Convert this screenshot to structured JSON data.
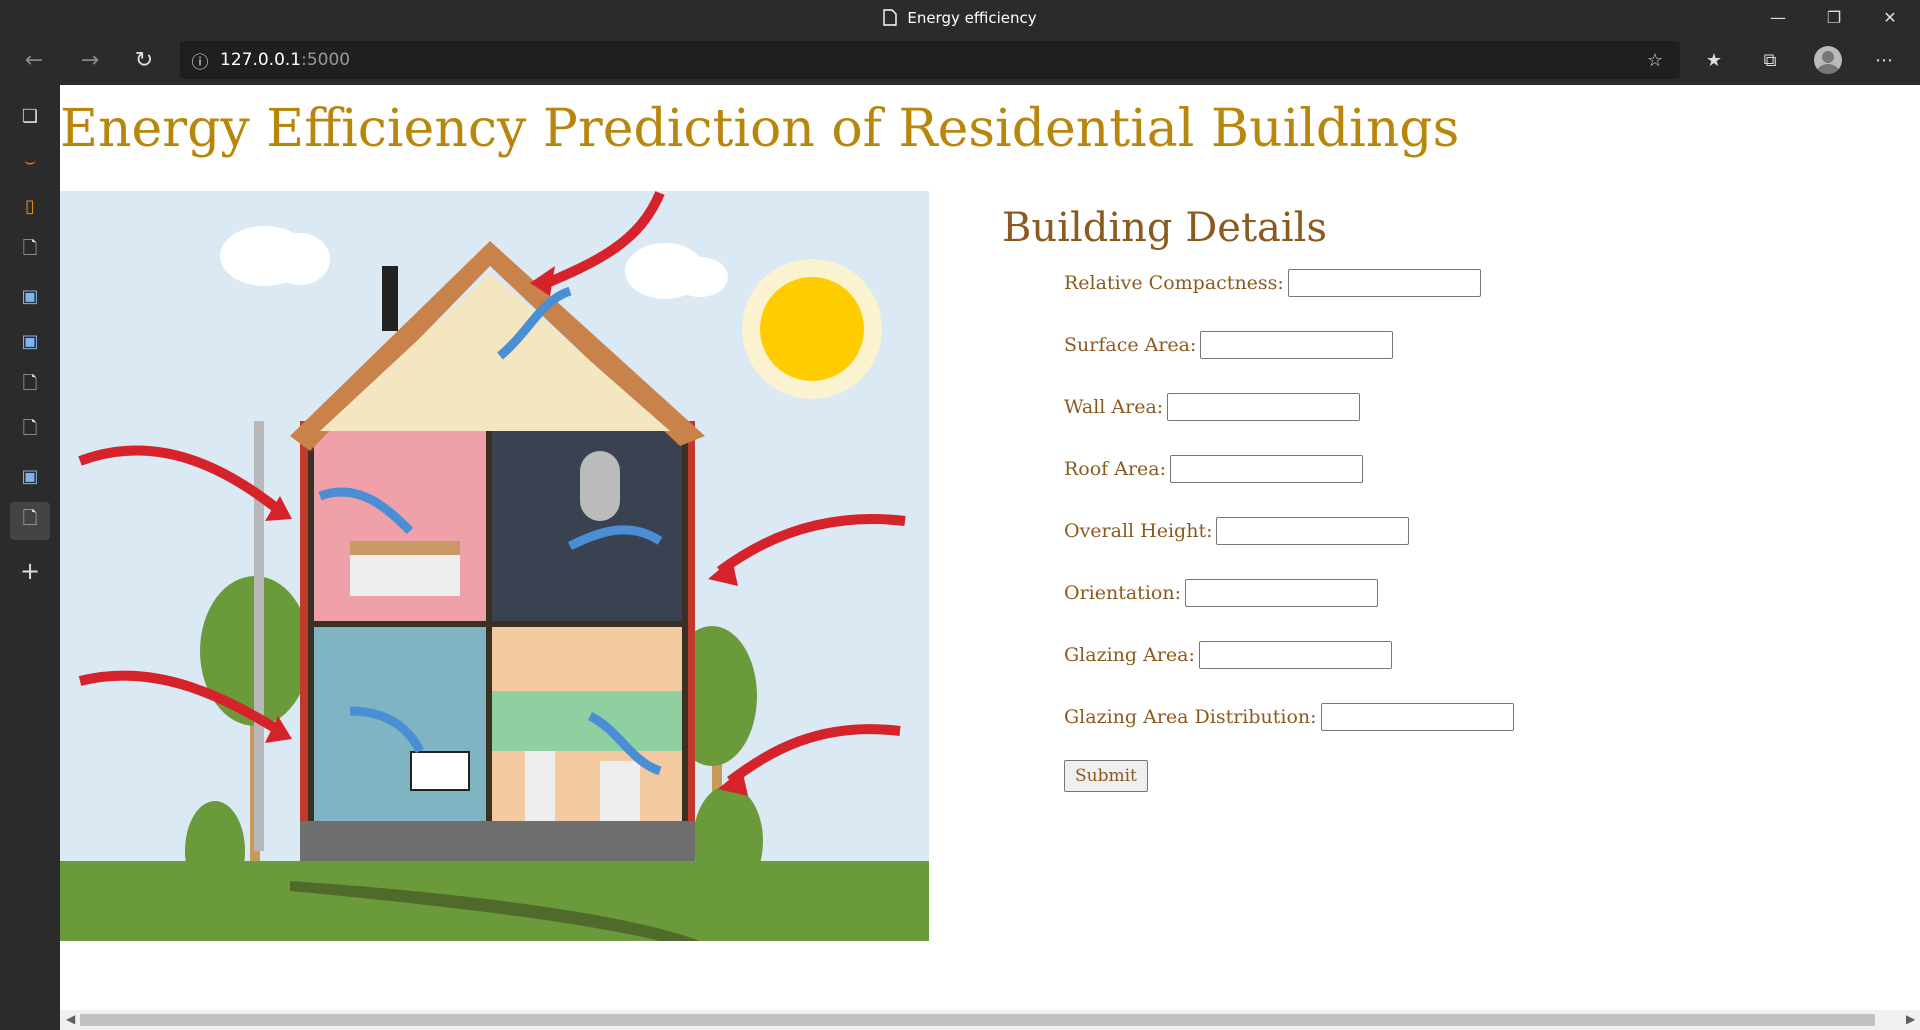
{
  "browser": {
    "tab_title": "Energy efficiency",
    "address_host": "127.0.0.1",
    "address_port": ":5000",
    "icons": [
      "back-icon",
      "forward-icon",
      "refresh-icon",
      "info-icon",
      "favorite-add-icon",
      "favorites-icon",
      "collections-icon",
      "profile-icon",
      "more-icon"
    ]
  },
  "sidebar": {
    "tabs": [
      "tab-actions-icon",
      "arc-icon",
      "book-icon",
      "page-icon",
      "terminal-icon",
      "terminal-icon",
      "page-icon",
      "page-icon",
      "terminal-icon",
      "page-icon",
      "add-icon"
    ]
  },
  "page": {
    "title": "Energy Efficiency Prediction of Residential Buildings",
    "form": {
      "title": "Building Details",
      "fields": [
        {
          "label": "Relative Compactness:",
          "value": ""
        },
        {
          "label": "Surface Area:",
          "value": ""
        },
        {
          "label": "Wall Area:",
          "value": ""
        },
        {
          "label": "Roof Area:",
          "value": ""
        },
        {
          "label": "Overall Height:",
          "value": ""
        },
        {
          "label": "Orientation:",
          "value": ""
        },
        {
          "label": "Glazing Area:",
          "value": ""
        },
        {
          "label": "Glazing Area Distribution:",
          "value": ""
        }
      ],
      "submit_label": "Submit"
    }
  },
  "colors": {
    "title": "#b8860b",
    "form_text": "#8b5a1f",
    "sky": "#dbe9f5",
    "grass": "#6a9a3a",
    "arrow_red": "#d6222a",
    "arrow_blue": "#4a8fd6"
  }
}
